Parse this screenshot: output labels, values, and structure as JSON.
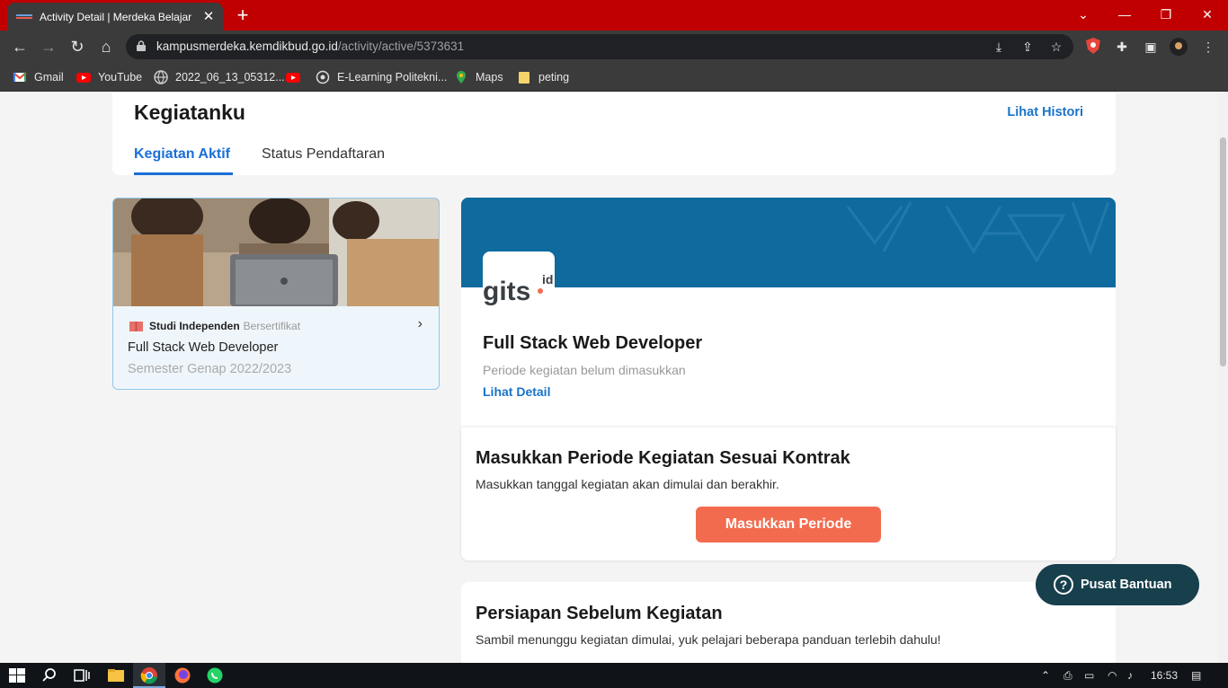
{
  "browser": {
    "tab_title": "Activity Detail | Merdeka Belajar",
    "tab_close": "✕",
    "new_tab": "+",
    "url_host": "kampusmerdeka.kemdikbud.go.id",
    "url_path": "/activity/active/5373631",
    "bookmarks": [
      {
        "label": "Gmail",
        "icon": "gmail-icon"
      },
      {
        "label": "YouTube",
        "icon": "youtube-icon"
      },
      {
        "label": "2022_06_13_05312...",
        "icon": "globe-icon"
      },
      {
        "label": "",
        "icon": "youtube-icon"
      },
      {
        "label": "E-Learning Politekni...",
        "icon": "politeknik-icon"
      },
      {
        "label": "Maps",
        "icon": "maps-icon"
      },
      {
        "label": "peting",
        "icon": "folder-icon"
      }
    ]
  },
  "header": {
    "title": "Kegiatanku",
    "history_link": "Lihat Histori",
    "tabs": [
      {
        "label": "Kegiatan Aktif",
        "active": true
      },
      {
        "label": "Status Pendaftaran",
        "active": false
      }
    ]
  },
  "activity_card": {
    "type_bold": "Studi Independen",
    "type_light": "Bersertifikat",
    "name": "Full Stack Web Developer",
    "semester": "Semester Genap 2022/2023",
    "chevron": "›"
  },
  "detail": {
    "logo_text": "gits",
    "logo_suffix": "id",
    "title": "Full Stack Web Developer",
    "period": "Periode kegiatan belum dimasukkan",
    "link": "Lihat Detail"
  },
  "period_section": {
    "title": "Masukkan Periode Kegiatan Sesuai Kontrak",
    "description": "Masukkan tanggal kegiatan akan dimulai dan berakhir.",
    "button": "Masukkan Periode"
  },
  "prep_section": {
    "title": "Persiapan Sebelum Kegiatan",
    "description": "Sambil menunggu kegiatan dimulai, yuk pelajari beberapa panduan terlebih dahulu!"
  },
  "help_button": {
    "label": "Pusat Bantuan",
    "icon": "?"
  },
  "taskbar": {
    "time": "16:53"
  },
  "colors": {
    "browser_frame": "#c00000",
    "accent_blue": "#1a6fd6",
    "banner": "#0f6a9e",
    "cta": "#f26b4f",
    "help": "#173f4c"
  }
}
